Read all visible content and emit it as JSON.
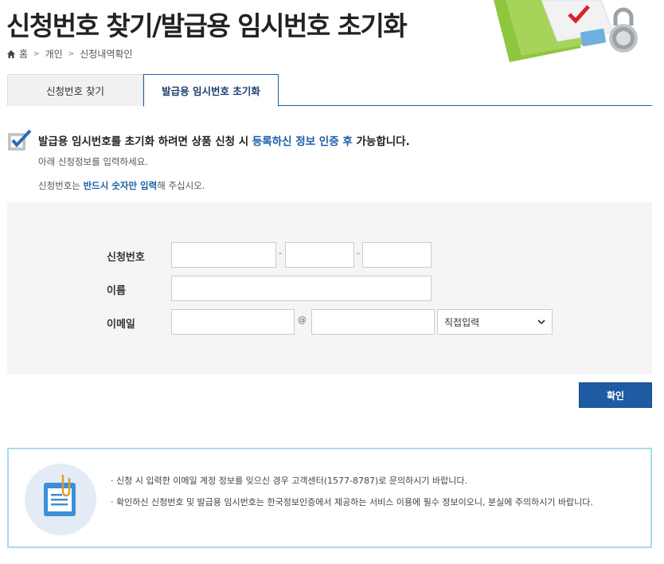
{
  "page": {
    "title": "신청번호 찾기/발급용 임시번호 초기화"
  },
  "breadcrumb": {
    "items": [
      "홈",
      "개인",
      "신청내역확인"
    ]
  },
  "tabs": [
    {
      "label": "신청번호 찾기",
      "active": false
    },
    {
      "label": "발급용 임시번호 초기화",
      "active": true
    }
  ],
  "notice": {
    "headline_prefix": "발급용 임시번호를 초기화 하려면 상품 신청 시 ",
    "headline_highlight": "등록하신 정보 인증 후",
    "headline_suffix": " 가능합니다.",
    "sub1": "아래 신청정보를 입력하세요.",
    "sub2_prefix": "신청번호는 ",
    "sub2_highlight": "반드시 숫자만 입력",
    "sub2_suffix": "해 주십시오."
  },
  "form": {
    "application_number_label": "신청번호",
    "name_label": "이름",
    "email_label": "이메일",
    "dash": "-",
    "at": "@",
    "email_domain_select": "직접입력"
  },
  "actions": {
    "confirm_label": "확인"
  },
  "info": {
    "line1": "· 신청 시 입력한 이메일 계정 정보를 잊으신 경우 고객센터(1577-8787)로 문의하시기 바랍니다.",
    "line2": "· 확인하신 신청번호 및 발급용 임시번호는 한국정보인증에서 제공하는 서비스 이용에 필수 정보이오니, 분실에 주의하시기 바랍니다."
  },
  "colors": {
    "accent": "#1a5fa8",
    "button": "#1d5ba3",
    "info_border": "#a8dcea"
  }
}
